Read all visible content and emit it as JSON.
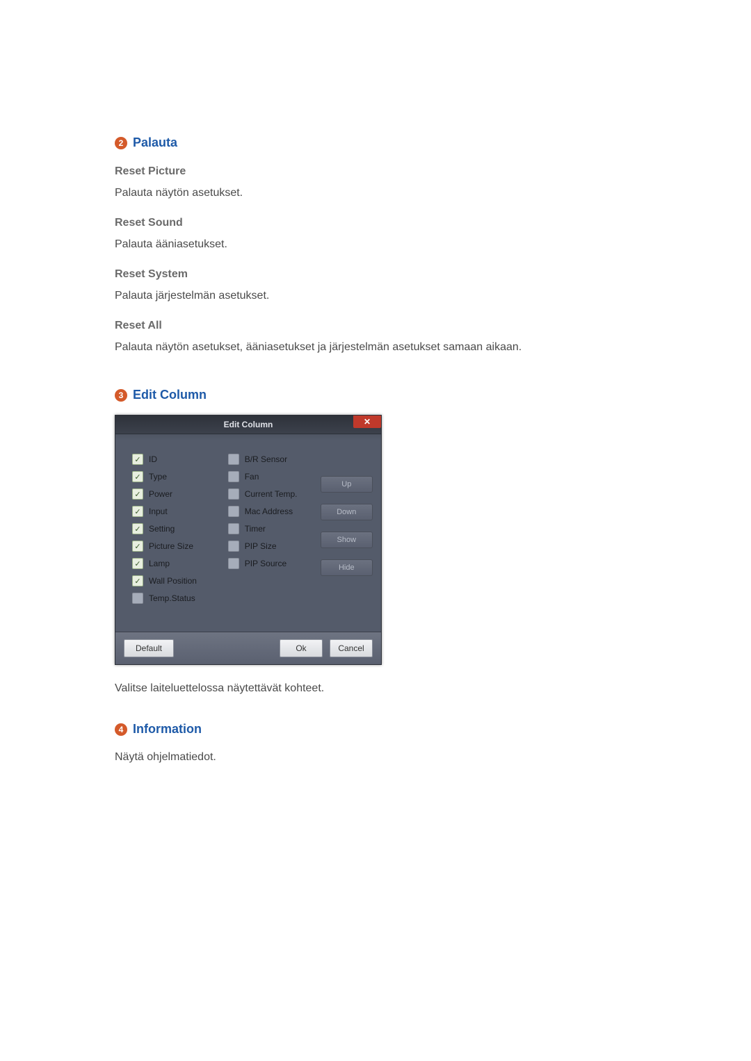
{
  "sections": {
    "palauta": {
      "badge": "2",
      "title": "Palauta",
      "items": [
        {
          "heading": "Reset Picture",
          "desc": "Palauta näytön asetukset."
        },
        {
          "heading": "Reset Sound",
          "desc": "Palauta ääniasetukset."
        },
        {
          "heading": "Reset System",
          "desc": "Palauta järjestelmän asetukset."
        },
        {
          "heading": "Reset All",
          "desc": "Palauta näytön asetukset, ääniasetukset ja järjestelmän asetukset samaan aikaan."
        }
      ]
    },
    "edit_column": {
      "badge": "3",
      "title": "Edit Column",
      "dialog": {
        "title": "Edit Column",
        "close": "✕",
        "col_left": [
          {
            "label": "ID",
            "checked": true
          },
          {
            "label": "Type",
            "checked": true
          },
          {
            "label": "Power",
            "checked": true
          },
          {
            "label": "Input",
            "checked": true
          },
          {
            "label": "Setting",
            "checked": true
          },
          {
            "label": "Picture Size",
            "checked": true
          },
          {
            "label": "Lamp",
            "checked": true
          },
          {
            "label": "Wall Position",
            "checked": true
          },
          {
            "label": "Temp.Status",
            "checked": false
          }
        ],
        "col_mid": [
          {
            "label": "B/R Sensor",
            "checked": false
          },
          {
            "label": "Fan",
            "checked": false
          },
          {
            "label": "Current Temp.",
            "checked": false
          },
          {
            "label": "Mac Address",
            "checked": false
          },
          {
            "label": "Timer",
            "checked": false
          },
          {
            "label": "PIP Size",
            "checked": false
          },
          {
            "label": "PIP Source",
            "checked": false
          }
        ],
        "side_buttons": [
          "Up",
          "Down",
          "Show",
          "Hide"
        ],
        "footer": {
          "default": "Default",
          "ok": "Ok",
          "cancel": "Cancel"
        }
      },
      "caption": "Valitse laiteluettelossa näytettävät kohteet."
    },
    "information": {
      "badge": "4",
      "title": "Information",
      "desc": "Näytä ohjelmatiedot."
    }
  }
}
